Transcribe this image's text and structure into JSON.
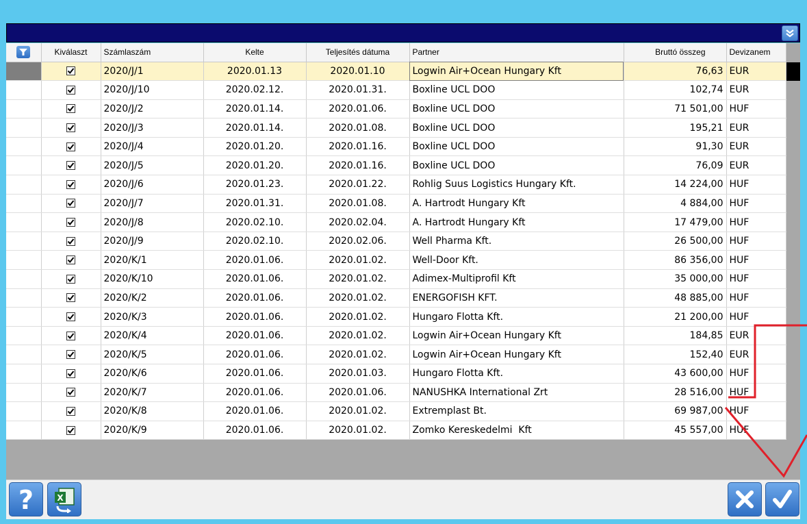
{
  "columns": {
    "select": "Kiválaszt",
    "invoice_no": "Számlaszám",
    "date": "Kelte",
    "fulfillment": "Teljesítés dátuma",
    "partner": "Partner",
    "gross": "Bruttó összeg",
    "currency": "Devizanem"
  },
  "rows": [
    {
      "checked": true,
      "invoice_no": "2020/J/1",
      "date": "2020.01.13",
      "fulfillment": "2020.01.10",
      "partner": "Logwin Air+Ocean Hungary Kft",
      "gross": "76,63",
      "currency": "EUR"
    },
    {
      "checked": true,
      "invoice_no": "2020/J/10",
      "date": "2020.02.12.",
      "fulfillment": "2020.01.31.",
      "partner": "Boxline UCL DOO",
      "gross": "102,74",
      "currency": "EUR"
    },
    {
      "checked": true,
      "invoice_no": "2020/J/2",
      "date": "2020.01.14.",
      "fulfillment": "2020.01.06.",
      "partner": "Boxline UCL DOO",
      "gross": "71 501,00",
      "currency": "HUF"
    },
    {
      "checked": true,
      "invoice_no": "2020/J/3",
      "date": "2020.01.14.",
      "fulfillment": "2020.01.08.",
      "partner": "Boxline UCL DOO",
      "gross": "195,21",
      "currency": "EUR"
    },
    {
      "checked": true,
      "invoice_no": "2020/J/4",
      "date": "2020.01.20.",
      "fulfillment": "2020.01.16.",
      "partner": "Boxline UCL DOO",
      "gross": "91,30",
      "currency": "EUR"
    },
    {
      "checked": true,
      "invoice_no": "2020/J/5",
      "date": "2020.01.20.",
      "fulfillment": "2020.01.16.",
      "partner": "Boxline UCL DOO",
      "gross": "76,09",
      "currency": "EUR"
    },
    {
      "checked": true,
      "invoice_no": "2020/J/6",
      "date": "2020.01.23.",
      "fulfillment": "2020.01.22.",
      "partner": "Rohlig Suus Logistics Hungary Kft.",
      "gross": "14 224,00",
      "currency": "HUF"
    },
    {
      "checked": true,
      "invoice_no": "2020/J/7",
      "date": "2020.01.31.",
      "fulfillment": "2020.01.08.",
      "partner": "A. Hartrodt Hungary Kft",
      "gross": "4 884,00",
      "currency": "HUF"
    },
    {
      "checked": true,
      "invoice_no": "2020/J/8",
      "date": "2020.02.10.",
      "fulfillment": "2020.02.04.",
      "partner": "A. Hartrodt Hungary Kft",
      "gross": "17 479,00",
      "currency": "HUF"
    },
    {
      "checked": true,
      "invoice_no": "2020/J/9",
      "date": "2020.02.10.",
      "fulfillment": "2020.02.06.",
      "partner": "Well Pharma Kft.",
      "gross": "26 500,00",
      "currency": "HUF"
    },
    {
      "checked": true,
      "invoice_no": "2020/K/1",
      "date": "2020.01.06.",
      "fulfillment": "2020.01.02.",
      "partner": "Well-Door Kft.",
      "gross": "86 356,00",
      "currency": "HUF"
    },
    {
      "checked": true,
      "invoice_no": "2020/K/10",
      "date": "2020.01.06.",
      "fulfillment": "2020.01.02.",
      "partner": "Adimex-Multiprofil Kft",
      "gross": "35 000,00",
      "currency": "HUF"
    },
    {
      "checked": true,
      "invoice_no": "2020/K/2",
      "date": "2020.01.06.",
      "fulfillment": "2020.01.02.",
      "partner": "ENERGOFISH KFT.",
      "gross": "48 885,00",
      "currency": "HUF"
    },
    {
      "checked": true,
      "invoice_no": "2020/K/3",
      "date": "2020.01.06.",
      "fulfillment": "2020.01.02.",
      "partner": "Hungaro Flotta Kft.",
      "gross": "21 200,00",
      "currency": "HUF"
    },
    {
      "checked": true,
      "invoice_no": "2020/K/4",
      "date": "2020.01.06.",
      "fulfillment": "2020.01.02.",
      "partner": "Logwin Air+Ocean Hungary Kft",
      "gross": "184,85",
      "currency": "EUR"
    },
    {
      "checked": true,
      "invoice_no": "2020/K/5",
      "date": "2020.01.06.",
      "fulfillment": "2020.01.02.",
      "partner": "Logwin Air+Ocean Hungary Kft",
      "gross": "152,40",
      "currency": "EUR"
    },
    {
      "checked": true,
      "invoice_no": "2020/K/6",
      "date": "2020.01.06.",
      "fulfillment": "2020.01.03.",
      "partner": "Hungaro Flotta Kft.",
      "gross": "43 600,00",
      "currency": "HUF"
    },
    {
      "checked": true,
      "invoice_no": "2020/K/7",
      "date": "2020.01.06.",
      "fulfillment": "2020.01.06.",
      "partner": "NANUSHKA International Zrt",
      "gross": "28 516,00",
      "currency": "HUF"
    },
    {
      "checked": true,
      "invoice_no": "2020/K/8",
      "date": "2020.01.06.",
      "fulfillment": "2020.01.02.",
      "partner": "Extremplast Bt.",
      "gross": "69 987,00",
      "currency": "HUF"
    },
    {
      "checked": true,
      "invoice_no": "2020/K/9",
      "date": "2020.01.06.",
      "fulfillment": "2020.01.02.",
      "partner": "Zomko Kereskedelmi  Kft",
      "gross": "45 557,00",
      "currency": "HUF"
    }
  ],
  "selected_row": 0,
  "icons": {
    "filter": "filter-icon",
    "collapse": "double-chevron-down-icon",
    "help": "help-icon",
    "excel": "excel-export-icon",
    "cancel": "close-icon",
    "confirm": "checkmark-icon"
  },
  "colors": {
    "background": "#5bc8ee",
    "titlebar": "#0b0b6e",
    "selected_row": "#fdf4c8",
    "annotation": "#e0202a"
  }
}
